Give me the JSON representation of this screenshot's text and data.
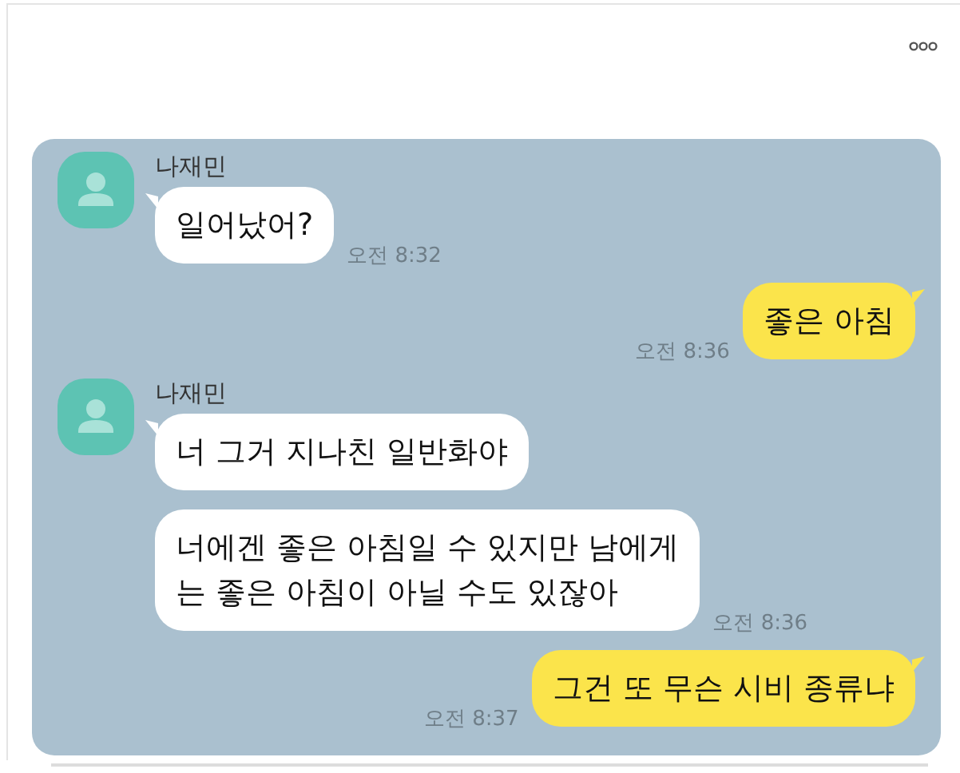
{
  "post": {
    "chat": {
      "messages": [
        {
          "kind": "received",
          "sender": "나재민",
          "text": "일어났어?",
          "time": "오전 8:32"
        },
        {
          "kind": "sent",
          "text": "좋은 아침",
          "time": "오전 8:36"
        },
        {
          "kind": "received",
          "sender": "나재민",
          "text": "너 그거 지나친 일반화야"
        },
        {
          "kind": "received",
          "text": "너에겐 좋은 아침일 수 있지만 남에게\n는 좋은 아침이 아닐 수도 있잖아",
          "time": "오전 8:36"
        },
        {
          "kind": "sent",
          "text": "그건 또 무슨 시비 종류냐",
          "time": "오전 8:37"
        }
      ]
    }
  }
}
